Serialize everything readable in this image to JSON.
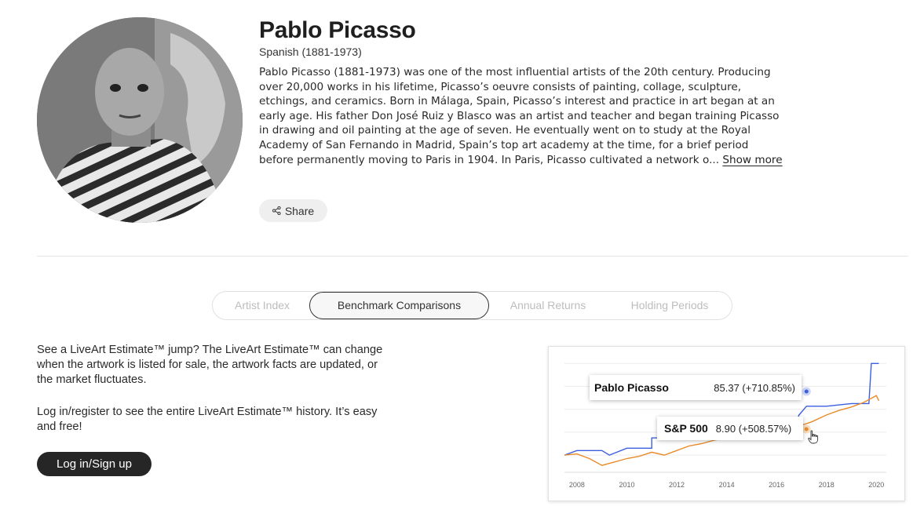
{
  "artist": {
    "name": "Pablo Picasso",
    "meta": "Spanish (1881-1973)",
    "bio": "Pablo Picasso (1881-1973) was one of the most influential artists of the 20th century. Producing over 20,000 works in his lifetime, Picasso’s oeuvre consists of painting, collage, sculpture, etchings, and ceramics. Born in Málaga, Spain, Picasso’s interest and practice in art began at an early age. His father Don José Ruiz y Blasco was an artist and teacher and began training Picasso in drawing and oil painting at the age of seven. He eventually went on to study at the Royal Academy of San Fernando in Madrid, Spain’s top art academy at the time, for a brief period before permanently moving to Paris in 1904. In Paris, Picasso cultivated a network o...",
    "show_more": "Show more",
    "share_label": "Share",
    "share_icon": "share-icon"
  },
  "tabs": [
    {
      "label": "Artist Index",
      "active": false
    },
    {
      "label": "Benchmark Comparisons",
      "active": true
    },
    {
      "label": "Annual Returns",
      "active": false
    },
    {
      "label": "Holding Periods",
      "active": false
    }
  ],
  "info": {
    "paragraph1": "See a LiveArt Estimate™ jump? The LiveArt Estimate™ can change when the artwork is listed for sale, the artwork facts are updated, or the market fluctuates.",
    "paragraph2": "Log in/register to see the entire LiveArt Estimate™ history. It’s easy and free!",
    "login_label": "Log in/Sign up"
  },
  "chart_data": {
    "type": "line",
    "title": "",
    "xlabel": "",
    "ylabel": "",
    "x_ticks": [
      "2008",
      "2010",
      "2012",
      "2014",
      "2016",
      "2018",
      "2020"
    ],
    "grid": true,
    "series": [
      {
        "name": "Pablo Picasso",
        "color": "#3b5fe0",
        "points": [
          [
            2007.5,
            0
          ],
          [
            2008,
            8
          ],
          [
            2009,
            8
          ],
          [
            2009.3,
            0
          ],
          [
            2010,
            12
          ],
          [
            2011,
            12
          ],
          [
            2011,
            30
          ],
          [
            2013,
            30
          ],
          [
            2014.5,
            30
          ],
          [
            2016.5,
            30
          ],
          [
            2016.9,
            70
          ],
          [
            2017.2,
            85.37
          ],
          [
            2018,
            85.37
          ],
          [
            2019,
            90
          ],
          [
            2019.7,
            90
          ],
          [
            2019.8,
            160
          ],
          [
            2020.1,
            160
          ]
        ]
      },
      {
        "name": "S&P 500",
        "color": "#e88b2a",
        "points": [
          [
            2007.5,
            0
          ],
          [
            2008,
            2
          ],
          [
            2008.5,
            -6
          ],
          [
            2009,
            -18
          ],
          [
            2009.5,
            -12
          ],
          [
            2010,
            -6
          ],
          [
            2010.5,
            -2
          ],
          [
            2011,
            5
          ],
          [
            2011.5,
            0
          ],
          [
            2012,
            8
          ],
          [
            2012.5,
            16
          ],
          [
            2013,
            20
          ],
          [
            2013.5,
            26
          ],
          [
            2014,
            30
          ],
          [
            2014.5,
            34
          ],
          [
            2015,
            38
          ],
          [
            2015.5,
            40
          ],
          [
            2016,
            42
          ],
          [
            2016.5,
            46
          ],
          [
            2017,
            52
          ],
          [
            2017.2,
            8.9
          ],
          [
            2017.4,
            58
          ],
          [
            2018,
            70
          ],
          [
            2018.5,
            78
          ],
          [
            2019,
            84
          ],
          [
            2019.5,
            92
          ],
          [
            2020,
            104
          ],
          [
            2020.1,
            95
          ]
        ]
      }
    ],
    "tooltips": [
      {
        "name": "Pablo Picasso",
        "value": "85.37 (+710.85%)"
      },
      {
        "name": "S&P 500",
        "value": "8.90 (+508.57%)"
      }
    ]
  }
}
